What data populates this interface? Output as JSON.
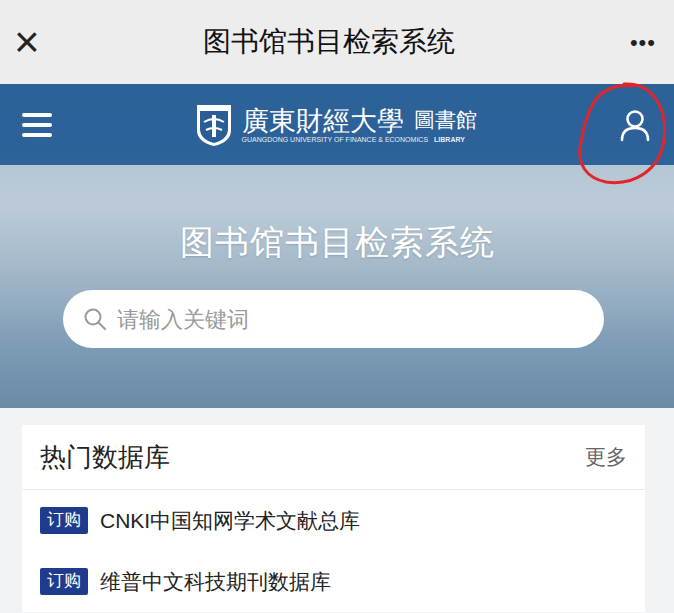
{
  "window": {
    "title": "图书馆书目检索系统",
    "close": "×",
    "more": "•••"
  },
  "header": {
    "logo_name": "廣東財經大學",
    "logo_library": "圖書館",
    "logo_english": "GUANGDONG UNIVERSITY OF FINANCE & ECONOMICS",
    "logo_english_tag": "LIBRARY"
  },
  "hero": {
    "title": "图书馆书目检索系统"
  },
  "search": {
    "placeholder": "请输入关键词"
  },
  "databases": {
    "title": "热门数据库",
    "more": "更多",
    "items": [
      {
        "badge": "订购",
        "name": "CNKI中国知网学术文献总库"
      },
      {
        "badge": "订购",
        "name": "维普中文科技期刊数据库"
      }
    ]
  }
}
